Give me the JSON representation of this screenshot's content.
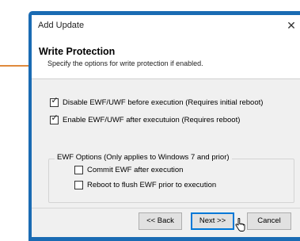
{
  "window": {
    "title": "Add Update"
  },
  "header": {
    "title": "Write Protection",
    "subtitle": "Specify the options for write protection if enabled."
  },
  "options": {
    "disable_ewf": {
      "label": "Disable EWF/UWF before execution (Requires initial reboot)",
      "checked": true
    },
    "enable_ewf": {
      "label": "Enable EWF/UWF after executuion (Requires reboot)",
      "checked": true
    }
  },
  "ewf_group": {
    "legend": "EWF Options (Only applies to Windows 7 and prior)",
    "commit": {
      "label": "Commit EWF after execution",
      "checked": false
    },
    "reboot": {
      "label": "Reboot to flush EWF prior to execution",
      "checked": false
    }
  },
  "buttons": {
    "back": "<< Back",
    "next": "Next >>",
    "cancel": "Cancel"
  },
  "colors": {
    "frame": "#1a6bb3",
    "dialog_bg": "#f0f0f0",
    "accent_line": "#e08a3c"
  }
}
